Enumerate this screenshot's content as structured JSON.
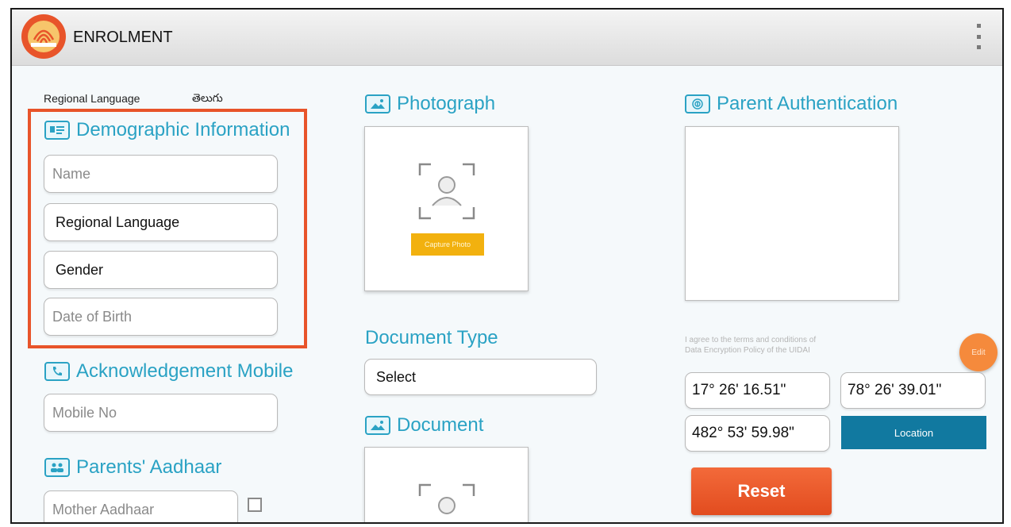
{
  "app": {
    "title": "ENROLMENT",
    "logo_icon": "aadhaar-fingerprint-logo",
    "menu_icon": "overflow-menu-icon"
  },
  "regional_language": {
    "label": "Regional Language",
    "value": "తెలుగు"
  },
  "demographic": {
    "title": "Demographic Information",
    "name_placeholder": "Name",
    "regional_language_field": "Regional Language",
    "gender_field": "Gender",
    "dob_placeholder": "Date of Birth"
  },
  "acknowledgement": {
    "title": "Acknowledgement Mobile",
    "mobile_placeholder": "Mobile No"
  },
  "parents": {
    "title": "Parents' Aadhaar",
    "mother_placeholder": "Mother Aadhaar"
  },
  "photograph": {
    "title": "Photograph",
    "capture_label": "Capture Photo"
  },
  "document_type": {
    "title": "Document Type",
    "selected": "Select"
  },
  "document": {
    "title": "Document"
  },
  "parent_auth": {
    "title": "Parent Authentication",
    "agree_line1": "I agree to the terms and conditions of",
    "agree_line2": "Data Encryption Policy of the UIDAI",
    "edit_label": "Edit"
  },
  "location": {
    "latitude": "17° 26' 16.51\"",
    "longitude": "78° 26' 39.01\"",
    "altitude": "482° 53' 59.98\"",
    "button_label": "Location"
  },
  "reset_label": "Reset",
  "colors": {
    "accent": "#2aa2c4",
    "highlight": "#e8542a",
    "location": "#1179a0",
    "reset": "#e8542a",
    "capture": "#f2b10f"
  }
}
